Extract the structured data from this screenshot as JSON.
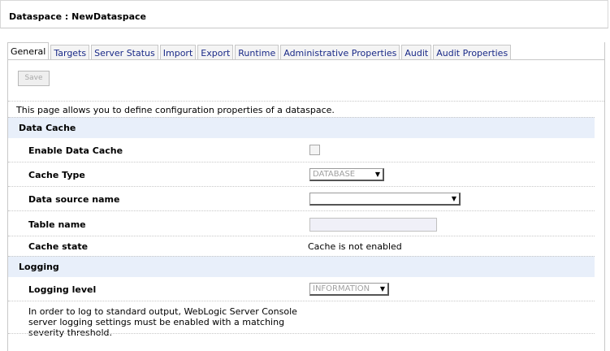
{
  "header": {
    "title": "Dataspace : NewDataspace"
  },
  "tabs": [
    {
      "label": "General",
      "active": true
    },
    {
      "label": "Targets"
    },
    {
      "label": "Server Status"
    },
    {
      "label": "Import"
    },
    {
      "label": "Export"
    },
    {
      "label": "Runtime"
    },
    {
      "label": "Administrative Properties"
    },
    {
      "label": "Audit"
    },
    {
      "label": "Audit Properties"
    }
  ],
  "toolbar": {
    "save_label": "Save"
  },
  "intro": "This page allows you to define configuration properties of a dataspace.",
  "data_cache": {
    "heading": "Data Cache",
    "enable_label": "Enable Data Cache",
    "enable_checked": false,
    "cache_type_label": "Cache Type",
    "cache_type_value": "DATABASE",
    "data_source_label": "Data source name",
    "data_source_value": "",
    "table_name_label": "Table name",
    "table_name_value": "",
    "cache_state_label": "Cache state",
    "cache_state_value": "Cache is not enabled"
  },
  "logging": {
    "heading": "Logging",
    "level_label": "Logging level",
    "level_value": "INFORMATION",
    "help_text": "In order to log to standard output, WebLogic Server Console server logging settings must be enabled with a matching severity threshold."
  },
  "colors": {
    "tab_link": "#1a2a88",
    "section_bg": "#e8effa"
  }
}
